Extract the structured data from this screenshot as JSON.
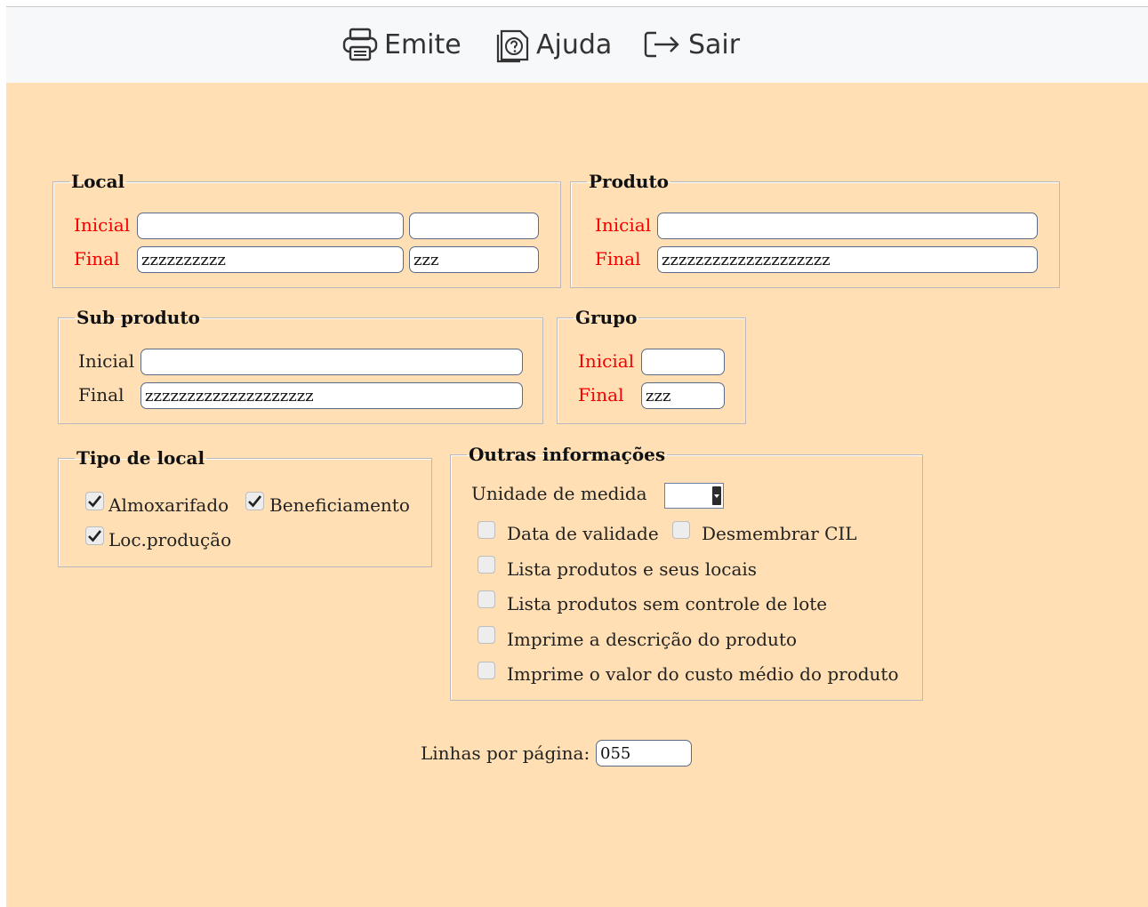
{
  "toolbar": {
    "emite_label": "Emite",
    "ajuda_label": "Ajuda",
    "sair_label": "Sair"
  },
  "local": {
    "legend": "Local",
    "inicial_label": "Inicial",
    "final_label": "Final",
    "inicial_value_1": "",
    "inicial_value_2": "",
    "final_value_1": "zzzzzzzzzz",
    "final_value_2": "zzz"
  },
  "produto": {
    "legend": "Produto",
    "inicial_label": "Inicial",
    "final_label": "Final",
    "inicial_value": "",
    "final_value": "zzzzzzzzzzzzzzzzzzzz"
  },
  "sub_produto": {
    "legend": "Sub produto",
    "inicial_label": "Inicial",
    "final_label": "Final",
    "inicial_value": "",
    "final_value": "zzzzzzzzzzzzzzzzzzzz"
  },
  "grupo": {
    "legend": "Grupo",
    "inicial_label": "Inicial",
    "final_label": "Final",
    "inicial_value": "",
    "final_value": "zzz"
  },
  "tipo_local": {
    "legend": "Tipo de local",
    "almoxarifado_label": "Almoxarifado",
    "beneficiamento_label": "Beneficiamento",
    "loc_producao_label": "Loc.produção",
    "almoxarifado_checked": true,
    "beneficiamento_checked": true,
    "loc_producao_checked": true
  },
  "outras": {
    "legend": "Outras informações",
    "unidade_label": "Unidade de medida",
    "unidade_value": "",
    "data_validade_label": "Data de validade",
    "desmembrar_label": "Desmembrar CIL",
    "lista_locais_label": "Lista produtos e seus locais",
    "lista_sem_lote_label": "Lista produtos sem controle de lote",
    "imprime_descricao_label": "Imprime a descrição do produto",
    "imprime_custo_label": "Imprime o valor do custo médio do produto"
  },
  "linhas": {
    "label": "Linhas por página:",
    "value": "055"
  },
  "colors": {
    "background": "#ffdfb3",
    "toolbar": "#f7f8fa",
    "required_label": "#f40000"
  }
}
